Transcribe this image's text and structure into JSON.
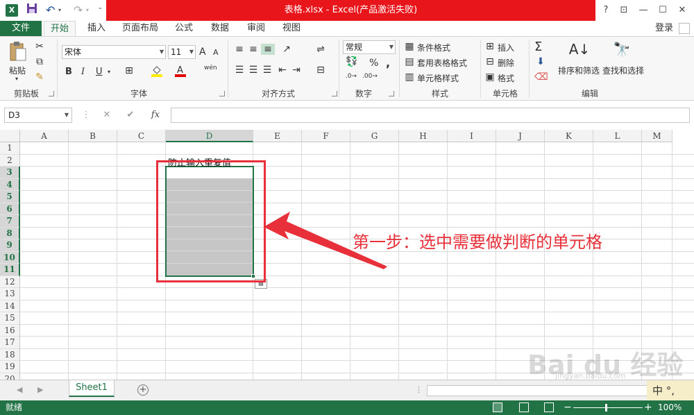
{
  "window": {
    "title": "表格.xlsx -  Excel(产品激活失败)",
    "buttons": {
      "help": "?",
      "ribbon_opts": "⊡",
      "minimize": "—",
      "maximize": "☐",
      "close": "✕"
    }
  },
  "quick_access": {
    "logo": "X",
    "save_icon": "floppy",
    "undo": "↶",
    "redo": "↷"
  },
  "tabs": {
    "file": "文件",
    "items": [
      "开始",
      "插入",
      "页面布局",
      "公式",
      "数据",
      "审阅",
      "视图"
    ],
    "active": "开始",
    "login": "登录"
  },
  "ribbon": {
    "clipboard": {
      "label": "剪贴板",
      "paste": "粘贴"
    },
    "font": {
      "label": "字体",
      "name": "宋体",
      "size": "11",
      "bold": "B",
      "italic": "I",
      "underline": "U",
      "grow": "A",
      "shrink": "A",
      "phonetic": "wén"
    },
    "alignment": {
      "label": "对齐方式"
    },
    "number": {
      "label": "数字",
      "format": "常规",
      "percent": "%",
      "comma": ","
    },
    "styles": {
      "label": "样式",
      "conditional": "条件格式",
      "table": "套用表格格式",
      "cell": "单元格样式"
    },
    "cells": {
      "label": "单元格",
      "insert": "插入",
      "delete": "删除",
      "format": "格式"
    },
    "editing": {
      "label": "编辑",
      "sum": "Σ",
      "sort": "排序和筛选",
      "find": "查找和选择"
    }
  },
  "formula_bar": {
    "name_box": "D3",
    "cancel": "✕",
    "enter": "✔",
    "fx": "fx",
    "value": ""
  },
  "grid": {
    "columns": [
      "A",
      "B",
      "C",
      "D",
      "E",
      "F",
      "G",
      "H",
      "I",
      "J",
      "K",
      "L",
      "M"
    ],
    "rows": [
      "1",
      "2",
      "3",
      "4",
      "5",
      "6",
      "7",
      "8",
      "9",
      "10",
      "11",
      "12",
      "13",
      "14",
      "15",
      "16",
      "17",
      "18",
      "19",
      "20"
    ],
    "selected_column": "D",
    "selected_rows": [
      "3",
      "4",
      "5",
      "6",
      "7",
      "8",
      "9",
      "10",
      "11"
    ],
    "cells": {
      "D2": "防止输入重复值"
    }
  },
  "annotation": {
    "text": "第一步：选中需要做判断的单元格",
    "color": "#e8303a"
  },
  "sheets": {
    "tabs": [
      "Sheet1"
    ],
    "active": "Sheet1",
    "add": "+"
  },
  "ime": {
    "text": "中 °,"
  },
  "status": {
    "ready": "就绪",
    "zoom": "100%",
    "zoom_minus": "−",
    "zoom_plus": "+"
  },
  "watermark": {
    "text": "Bai du 经验",
    "sub": "jingyan.baidu.com"
  },
  "colors": {
    "excel_green": "#217346",
    "title_red": "#e8161b",
    "annotation_red": "#e8303a"
  }
}
